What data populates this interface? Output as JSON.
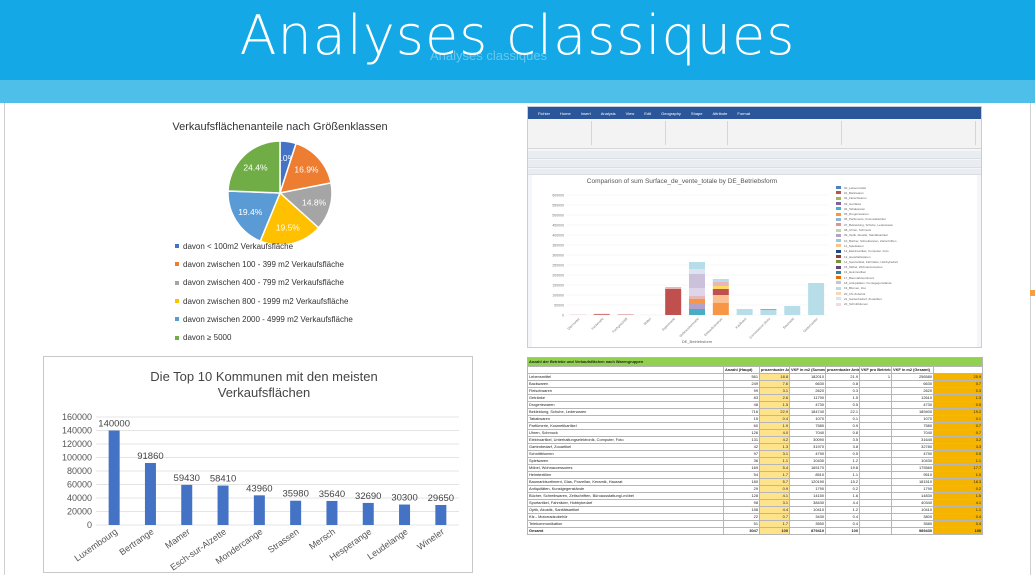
{
  "slide": {
    "title": "Analyses classiques",
    "ghost_text": "Analyses classiques"
  },
  "pie_chart": {
    "title": "Verkaufsflächenanteile nach Größenklassen",
    "legend": [
      "davon < 100m2 Verkaufsfläche",
      "davon zwischen 100 - 399 m2 Verkaufsfläche",
      "davon zwischen 400 - 799 m2 Verkaufsfläche",
      "davon zwischen 800 - 1999 m2 Verkaufsfläche",
      "davon zwischen 2000 - 4999 m2 Verkaufsfläche",
      "davon ≥ 5000"
    ]
  },
  "bar_chart_panel": {
    "title_line1": "Die Top 10 Kommunen mit den meisten",
    "title_line2": "Verkaufsflächen"
  },
  "screenshot_panel": {
    "ribbon_tabs": [
      "Fichier",
      "Home",
      "Insert",
      "Analysis",
      "View",
      "Edit",
      "Geography",
      "Shape",
      "Attribute",
      "Format"
    ],
    "chart_title": "Comparison of sum Surface_de_vente_totale by DE_Betriebsform",
    "x_axis_label": "DE_Betriebsform",
    "legend": [
      "00_Lebensmittel",
      "01_Backwaren",
      "02_Fleischwaren",
      "03_Getränke",
      "04_Tabakwaren",
      "05_Drogeriewaren",
      "06_Parfümerie, Kosmetikartikel",
      "07_Bekleidung, Schuhe, Lederwaren",
      "08_Uhren, Schmuck",
      "09_Optik, Akustik, Sanitätsartikel",
      "10_Bücher, Schreibwaren, Zeitschriften",
      "11_Spielwaren",
      "12_Elektroartikel, Computer, Foto",
      "13_Haushaltswaren",
      "14_Sportartikel, Fahrräder, Hobbybedarf",
      "15_Möbel, Wohnaccessoires",
      "16_Heimtextilien",
      "17_Baumarktsortiment",
      "18_Antiquitäten, Kunstgegenstände",
      "19_Blumen, Zoo",
      "20_Kfz-Zubehör",
      "21_Gartenbedarf, Zooartikel",
      "22_Schnittblumen"
    ],
    "legend_colors": [
      "#4f81bd",
      "#c0504d",
      "#9bbb59",
      "#8064a2",
      "#4bacc6",
      "#f79646",
      "#95b3d7",
      "#d99694",
      "#c3d69b",
      "#b3a2c7",
      "#93cddd",
      "#fac08f",
      "#1f497d",
      "#953735",
      "#77933c",
      "#604a7b",
      "#31859c",
      "#e46c0a",
      "#ccc1da",
      "#b7dee8",
      "#fcd5b4",
      "#dbe5f1",
      "#f2dcdb"
    ],
    "bars": [
      {
        "category": "Discounter",
        "segments": [
          {
            "value": 1500,
            "color": "#e6b9b8"
          }
        ]
      },
      {
        "category": "Fachmarkt",
        "segments": [
          {
            "value": 4000,
            "color": "#c0504d"
          },
          {
            "value": 2000,
            "color": "#e6b9b8"
          }
        ]
      },
      {
        "category": "Fachgeschäft",
        "segments": [
          {
            "value": 2000,
            "color": "#c0504d"
          }
        ]
      },
      {
        "category": "Möbel",
        "segments": [
          {
            "value": 1000,
            "color": "#f2dcdb"
          }
        ]
      },
      {
        "category": "Supermarkt",
        "segments": [
          {
            "value": 130000,
            "color": "#c0504d"
          },
          {
            "value": 10000,
            "color": "#e6b9b8"
          }
        ]
      },
      {
        "category": "Verbrauchermarkt",
        "segments": [
          {
            "value": 30000,
            "color": "#4bacc6"
          },
          {
            "value": 30000,
            "color": "#b3a2c7"
          },
          {
            "value": 20000,
            "color": "#f79646"
          },
          {
            "value": 15000,
            "color": "#e6b9b8"
          },
          {
            "value": 40000,
            "color": "#dfd5eb"
          },
          {
            "value": 70000,
            "color": "#ccc1da"
          },
          {
            "value": 25000,
            "color": "#dbe5f1"
          },
          {
            "value": 35000,
            "color": "#b7dee8"
          }
        ]
      },
      {
        "category": "Einkaufszentrum",
        "segments": [
          {
            "value": 60000,
            "color": "#f79646"
          },
          {
            "value": 40000,
            "color": "#fac08f"
          },
          {
            "value": 30000,
            "color": "#c0504d"
          },
          {
            "value": 15000,
            "color": "#ffd966"
          },
          {
            "value": 20000,
            "color": "#e6b9b8"
          },
          {
            "value": 15000,
            "color": "#b7dee8"
          }
        ]
      },
      {
        "category": "Kaufhaus",
        "segments": [
          {
            "value": 30000,
            "color": "#b7dee8"
          }
        ]
      },
      {
        "category": "Convenience Store",
        "segments": [
          {
            "value": 25000,
            "color": "#b7dee8"
          },
          {
            "value": 5000,
            "color": "#9bbb59"
          }
        ]
      },
      {
        "category": "Baumarkt",
        "segments": [
          {
            "value": 45000,
            "color": "#b7dee8"
          }
        ]
      },
      {
        "category": "Gartencenter",
        "segments": [
          {
            "value": 160000,
            "color": "#b7dee8"
          }
        ]
      }
    ],
    "y_ticks": [
      "600000",
      "550000",
      "500000",
      "450000",
      "400000",
      "350000",
      "300000",
      "250000",
      "200000",
      "150000",
      "100000",
      "50000",
      "0"
    ]
  },
  "table": {
    "title": "Anzahl der Betriebe und Verkaufsflächen nach Warengruppen",
    "columns": [
      "",
      "Anzahl (Haupt)",
      "prozentualer Anteil",
      "VKF in m2 (Summe)",
      "prozentualer Anteil",
      "VKF pro Betrieb",
      "VKF in m2 (Gesamt)",
      ""
    ],
    "rows": [
      [
        "Lebensmittel",
        "561",
        "18.8",
        "182010",
        "21.9",
        "1",
        "256580",
        "25.9"
      ],
      [
        "Backwaren",
        "249",
        "7.6",
        "6630",
        "0.8",
        "",
        "6630",
        "0.7"
      ],
      [
        "Fleischwaren",
        "99",
        "3.1",
        "2620",
        "0.3",
        "",
        "2620",
        "0.3"
      ],
      [
        "Getränke",
        "83",
        "2.6",
        "11790",
        "1.5",
        "",
        "12610",
        "1.3"
      ],
      [
        "Drogeriewaren",
        "48",
        "1.5",
        "4730",
        "0.5",
        "",
        "4730",
        "0.5"
      ],
      [
        "Bekleidung, Schuhe, Lederwaren",
        "716",
        "22.9",
        "184740",
        "22.1",
        "",
        "189400",
        "19.2"
      ],
      [
        "Tabakwaren",
        "15",
        "0.4",
        "1070",
        "0.1",
        "",
        "1070",
        "0.1"
      ],
      [
        "Parfümerie, Kosmetikartikel",
        "60",
        "1.9",
        "7580",
        "0.9",
        "",
        "7580",
        "0.7"
      ],
      [
        "Uhren, Schmuck",
        "126",
        "4.0",
        "7040",
        "0.8",
        "",
        "7040",
        "0.7"
      ],
      [
        "Elektroartikel, Unterhaltungselektronik, Computer, Foto",
        "131",
        "4.2",
        "30090",
        "3.5",
        "",
        "31640",
        "3.2"
      ],
      [
        "Gartenbedarf, Zooartikel",
        "42",
        "1.3",
        "31970",
        "3.8",
        "",
        "32780",
        "3.3"
      ],
      [
        "Schnittblumen",
        "97",
        "3.1",
        "4790",
        "0.5",
        "",
        "4790",
        "0.5"
      ],
      [
        "Spielwaren",
        "36",
        "1.1",
        "10430",
        "1.2",
        "",
        "10430",
        "1.1"
      ],
      [
        "Möbel, Wohnaccessoires",
        "169",
        "5.4",
        "165170",
        "19.8",
        "",
        "175560",
        "17.7"
      ],
      [
        "Heimtextilien",
        "54",
        "1.7",
        "8510",
        "1.1",
        "",
        "9510",
        "1.0"
      ],
      [
        "Baumarktsortiment, Glas, Porzellan, Keramik, Hausrat",
        "180",
        "5.7",
        "120190",
        "15.2",
        "",
        "181510",
        "18.3"
      ],
      [
        "Antiquitäten, Kunstgegenstände",
        "29",
        "0.9",
        "1790",
        "0.2",
        "",
        "1790",
        "0.2"
      ],
      [
        "Bücher, Schreibwaren, Zeitschriften, Büroausstattung/-möbel",
        "128",
        "4.1",
        "14150",
        "1.6",
        "",
        "14830",
        "1.5"
      ],
      [
        "Sportartikel, Fahrräder, Hobbybedarf",
        "98",
        "3.1",
        "38430",
        "4.4",
        "",
        "40340",
        "4.1"
      ],
      [
        "Optik, Akustik, Sanitätsartikel",
        "158",
        "4.4",
        "10410",
        "1.2",
        "",
        "10410",
        "1.1"
      ],
      [
        "Kfz.- Motorradzubehör",
        "22",
        "0.7",
        "3430",
        "0.4",
        "",
        "3800",
        "0.4"
      ],
      [
        "Telekommunikation",
        "51",
        "1.7",
        "3550",
        "0.4",
        "",
        "3580",
        "0.4"
      ],
      [
        "Gesamt",
        "3047",
        "100",
        "879410",
        "100",
        "",
        "989430",
        "100"
      ]
    ]
  },
  "chart_data": [
    {
      "type": "pie",
      "title": "Verkaufsflächenanteile nach Größenklassen",
      "labels": [
        "davon < 100m2 Verkaufsfläche",
        "davon zwischen 100 - 399 m2 Verkaufsfläche",
        "davon zwischen 400 - 799 m2 Verkaufsfläche",
        "davon zwischen 800 - 1999 m2 Verkaufsfläche",
        "davon zwischen 2000 - 4999 m2 Verkaufsfläche",
        "davon ≥ 5000"
      ],
      "value_labels": [
        "5.0%",
        "16.9%",
        "14.8%",
        "19.5%",
        "19.4%",
        "24.4%"
      ],
      "values": [
        5.0,
        16.9,
        14.8,
        19.5,
        19.4,
        24.4
      ],
      "colors": [
        "#4472c4",
        "#ed7d31",
        "#a5a5a5",
        "#ffc000",
        "#5b9bd5",
        "#70ad47"
      ],
      "legend": "bottom"
    },
    {
      "type": "bar",
      "title": "Die Top 10 Kommunen mit den meisten Verkaufsflächen",
      "categories": [
        "Luxembourg",
        "Bertrange",
        "Mamer",
        "Esch-sur-Alzette",
        "Mondercange",
        "Strassen",
        "Mersch",
        "Hesperange",
        "Leudelange",
        "Wineler"
      ],
      "values": [
        140000,
        91860,
        59430,
        58410,
        43960,
        35980,
        35640,
        32690,
        30300,
        29650
      ],
      "y_ticks": [
        "160000",
        "140000",
        "120000",
        "100000",
        "80000",
        "60000",
        "40000",
        "20000",
        "0"
      ],
      "ylim": [
        0,
        160000
      ],
      "color": "#4472c4",
      "grid": true
    }
  ]
}
